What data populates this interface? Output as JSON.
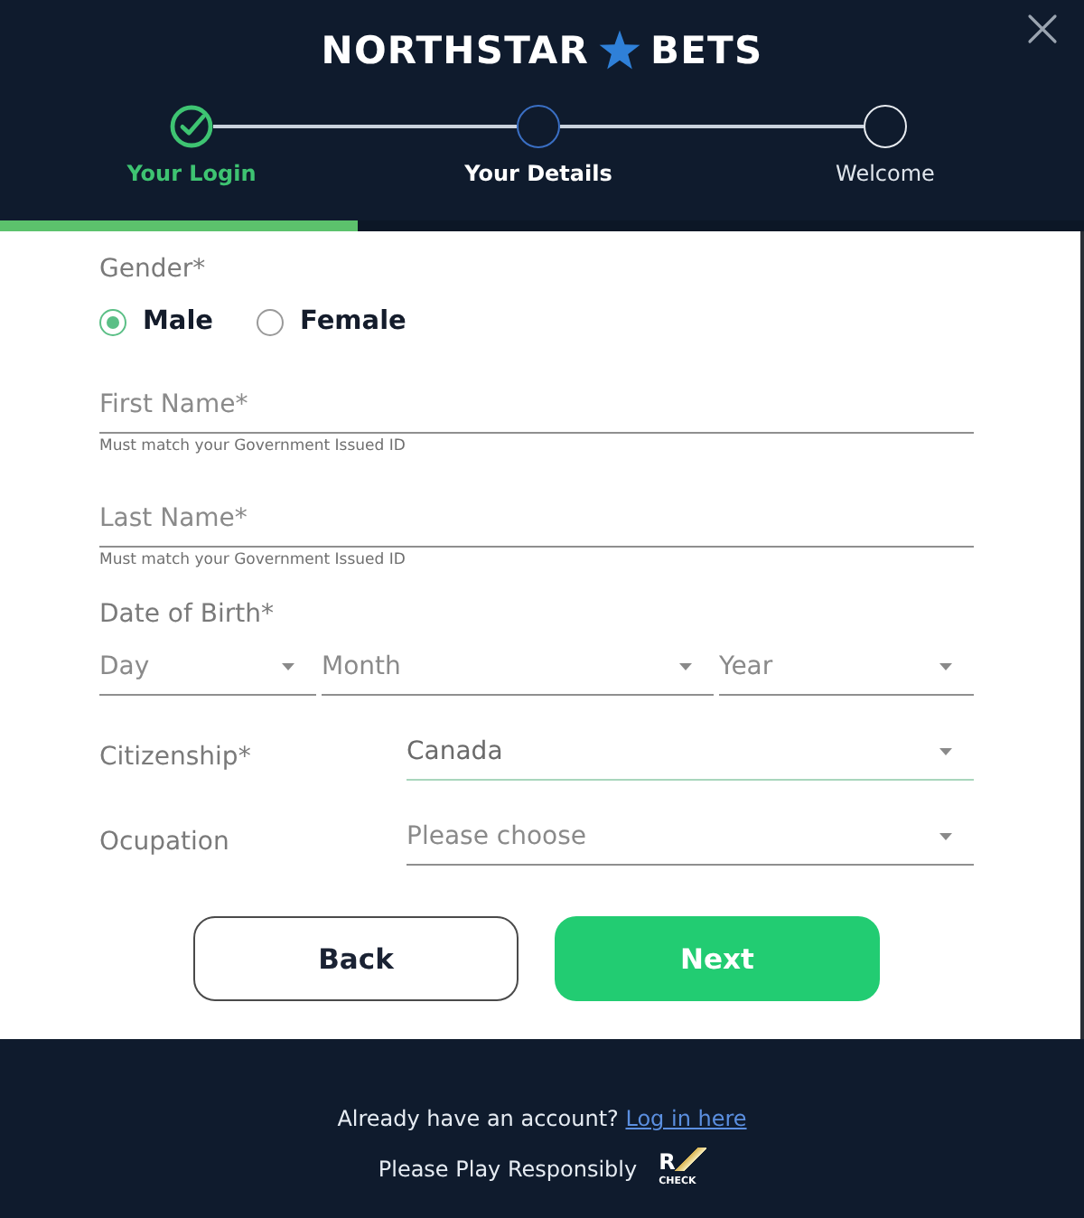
{
  "header": {
    "logo": {
      "left": "NORTHSTAR",
      "right": "BETS"
    },
    "steps": [
      {
        "label": "Your Login",
        "completed": true,
        "selected": false
      },
      {
        "label": "Your Details",
        "completed": false,
        "selected": true
      },
      {
        "label": "Welcome",
        "completed": false,
        "selected": false
      }
    ],
    "progress": {
      "level": 0.33
    }
  },
  "form": {
    "gender": {
      "label": "Gender*",
      "options": [
        {
          "label": "Male",
          "selected": true
        },
        {
          "label": "Female",
          "selected": false
        }
      ]
    },
    "name_fields": [
      {
        "placeholder": "First Name*",
        "hint": "Must match your Government Issued ID"
      },
      {
        "placeholder": "Last Name*",
        "hint": "Must match your Government Issued ID"
      }
    ],
    "date_of_birth": {
      "label": "Date of Birth*",
      "selects": [
        {
          "placeholder": "Day"
        },
        {
          "placeholder": "Month"
        },
        {
          "placeholder": "Year"
        }
      ]
    },
    "rows": [
      {
        "label": "Citizenship*",
        "value": "Canada",
        "focused": true
      },
      {
        "label": "Ocupation",
        "placeholder": "Please choose",
        "focused": false
      }
    ],
    "buttons": [
      {
        "label": "Back",
        "kind": "secondary"
      },
      {
        "label": "Next",
        "kind": "primary"
      }
    ]
  },
  "footer": {
    "account_prompt": "Already have an account?",
    "login_link": "Log in here",
    "responsible_text": "Please Play Responsibly",
    "badge": {
      "top": "R",
      "bottom": "CHECK"
    }
  }
}
